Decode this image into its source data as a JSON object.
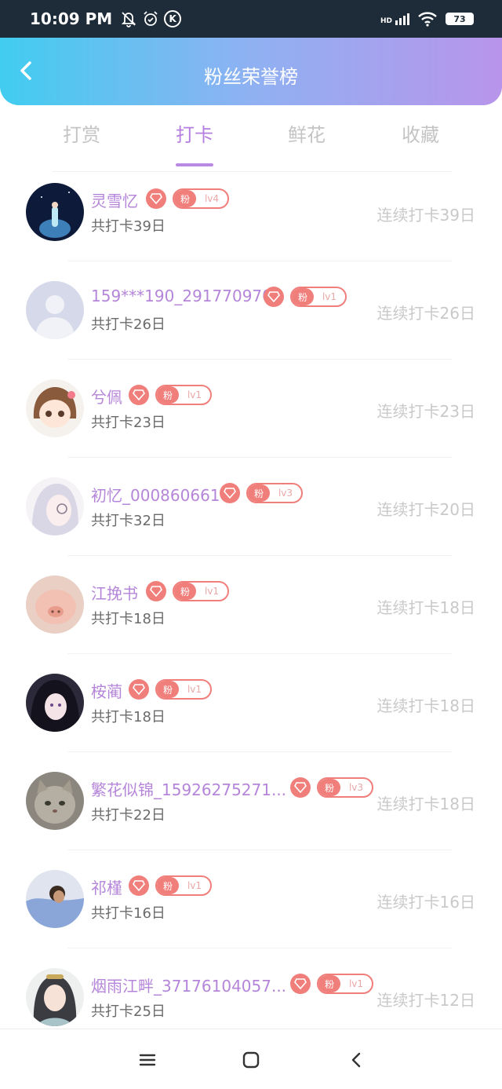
{
  "status": {
    "time": "10:09 PM",
    "network": "HD",
    "battery": "73",
    "k_label": "K"
  },
  "header": {
    "title": "粉丝荣誉榜"
  },
  "tabs": [
    {
      "label": "打赏",
      "active": false
    },
    {
      "label": "打卡",
      "active": true
    },
    {
      "label": "鲜花",
      "active": false
    },
    {
      "label": "收藏",
      "active": false
    }
  ],
  "fan_label": "粉",
  "list": [
    {
      "name": "灵雪忆",
      "level": "lv4",
      "total": "共打卡39日",
      "streak": "连续打卡39日",
      "avatar": "night-sky"
    },
    {
      "name": "159***190_291770970",
      "level": "lv1",
      "total": "共打卡26日",
      "streak": "连续打卡26日",
      "avatar": "default-silhouette"
    },
    {
      "name": "兮佩",
      "level": "lv1",
      "total": "共打卡23日",
      "streak": "连续打卡23日",
      "avatar": "anime-girl-brown"
    },
    {
      "name": "初忆_000860661",
      "level": "lv3",
      "total": "共打卡32日",
      "streak": "连续打卡20日",
      "avatar": "anime-girl-pale"
    },
    {
      "name": "江挽书",
      "level": "lv1",
      "total": "共打卡18日",
      "streak": "连续打卡18日",
      "avatar": "pig"
    },
    {
      "name": "桉蔺",
      "level": "lv1",
      "total": "共打卡18日",
      "streak": "连续打卡18日",
      "avatar": "anime-dark"
    },
    {
      "name": "繁花似锦_15926275271...",
      "level": "lv3",
      "total": "共打卡22日",
      "streak": "连续打卡18日",
      "avatar": "cat"
    },
    {
      "name": "祁槿",
      "level": "lv1",
      "total": "共打卡16日",
      "streak": "连续打卡16日",
      "avatar": "person-blue"
    },
    {
      "name": "烟雨江畔_37176104057...",
      "level": "lv1",
      "total": "共打卡25日",
      "streak": "连续打卡12日",
      "avatar": "ancient-lady"
    }
  ],
  "colors": {
    "accent": "#b57fe0",
    "badge": "#f07f7c",
    "header_start": "#41cdf0",
    "header_end": "#b895ea"
  }
}
